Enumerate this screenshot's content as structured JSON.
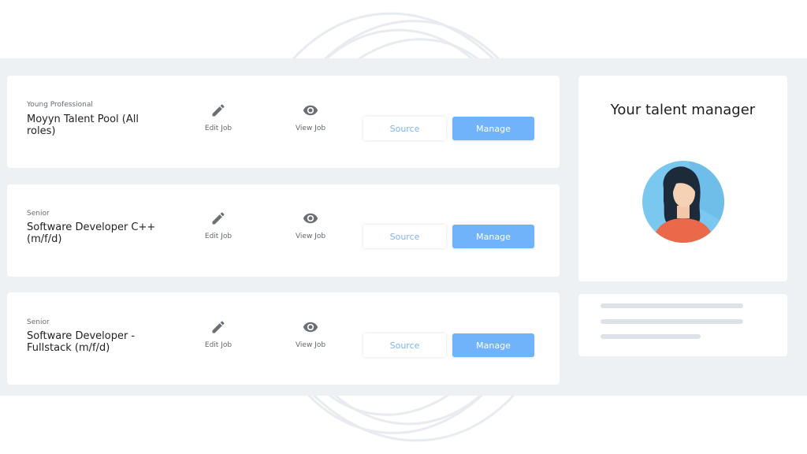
{
  "jobs": [
    {
      "level": "Young Professional",
      "title": "Moyyn Talent Pool (All roles)",
      "edit_label": "Edit Job",
      "view_label": "View Job",
      "source_label": "Source",
      "manage_label": "Manage"
    },
    {
      "level": "Senior",
      "title": "Software Developer C++ (m/f/d)",
      "edit_label": "Edit Job",
      "view_label": "View Job",
      "source_label": "Source",
      "manage_label": "Manage"
    },
    {
      "level": "Senior",
      "title": "Software Developer - Fullstack (m/f/d)",
      "edit_label": "Edit Job",
      "view_label": "View Job",
      "source_label": "Source",
      "manage_label": "Manage"
    }
  ],
  "talent_manager": {
    "title": "Your talent manager",
    "avatar_icon": "woman-avatar-icon"
  },
  "icons": {
    "edit": "pencil-icon",
    "view": "eye-icon"
  },
  "colors": {
    "accent": "#70b3fa",
    "source_text": "#7fb4f2",
    "background_band": "#eef1f4",
    "avatar_bg": "#7ac7ef",
    "shirt": "#e9694a"
  }
}
